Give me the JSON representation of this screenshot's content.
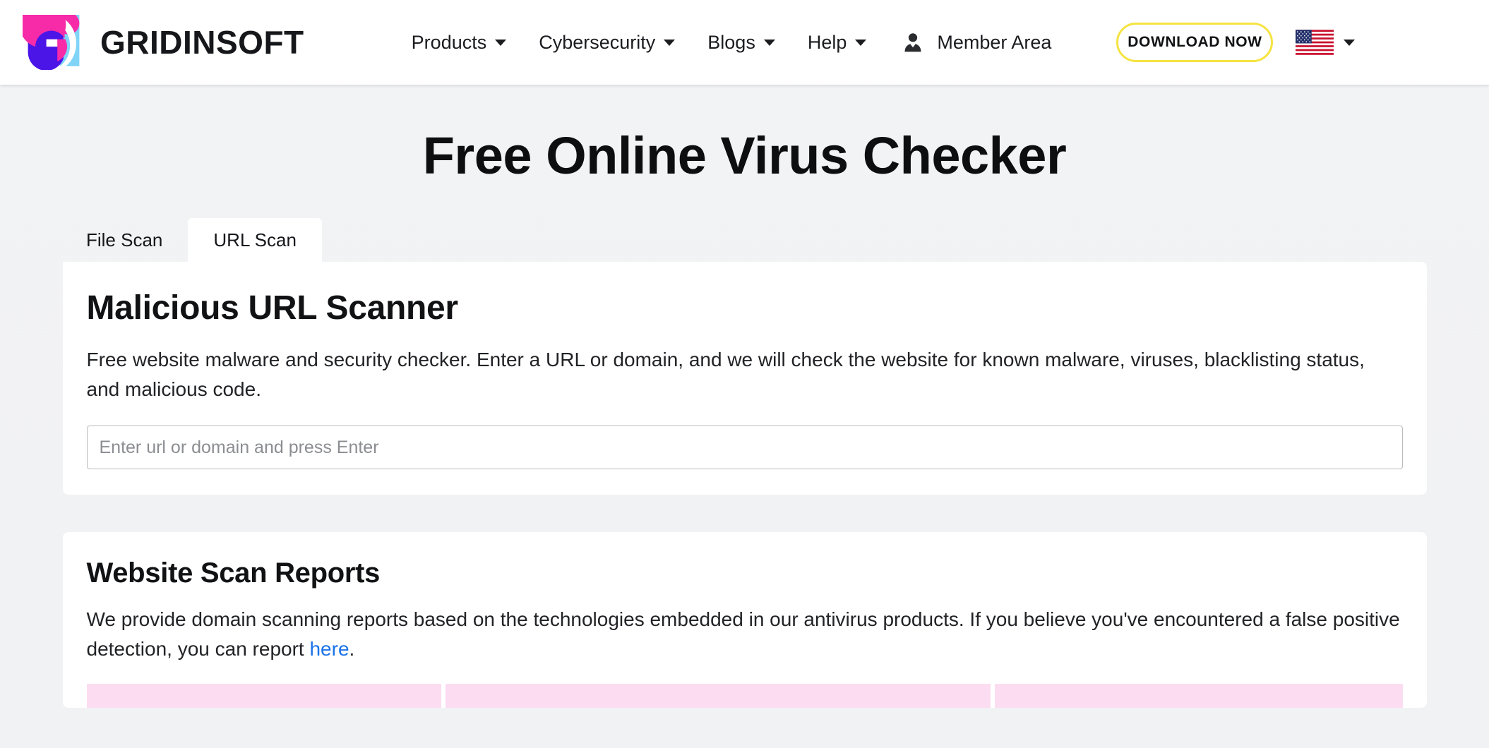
{
  "header": {
    "brand_name": "GRIDINSOFT",
    "logo_icon": "gridinsoft-logo-icon",
    "nav": [
      {
        "label": "Products",
        "has_dropdown": true,
        "icon": "chevron-down-icon"
      },
      {
        "label": "Cybersecurity",
        "has_dropdown": true,
        "icon": "chevron-down-icon"
      },
      {
        "label": "Blogs",
        "has_dropdown": true,
        "icon": "chevron-down-icon"
      },
      {
        "label": "Help",
        "has_dropdown": true,
        "icon": "chevron-down-icon"
      }
    ],
    "member_area": {
      "label": "Member Area",
      "icon": "person-icon"
    },
    "download_button": {
      "label": "DOWNLOAD NOW",
      "border_color": "#f5e342"
    },
    "language": {
      "icon": "us-flag-icon",
      "caret_icon": "chevron-down-icon"
    }
  },
  "page": {
    "title": "Free Online Virus Checker",
    "background_color": "#f2f3f5"
  },
  "tabs": [
    {
      "label": "File Scan",
      "active": false
    },
    {
      "label": "URL Scan",
      "active": true
    }
  ],
  "scanner": {
    "title": "Malicious URL Scanner",
    "description": "Free website malware and security checker. Enter a URL or domain, and we will check the website for known malware, viruses, blacklisting status, and malicious code.",
    "input": {
      "placeholder": "Enter url or domain and press Enter",
      "value": ""
    }
  },
  "reports": {
    "title": "Website Scan Reports",
    "description_before_link": "We provide domain scanning reports based on the technologies embedded in our antivirus products. If you believe you've encountered a false positive detection, you can report ",
    "link_label": "here",
    "description_after_link": ".",
    "link_color": "#1a73e8",
    "table": {
      "header_background": "#fcdcf1",
      "columns": [
        "",
        "",
        ""
      ]
    }
  }
}
